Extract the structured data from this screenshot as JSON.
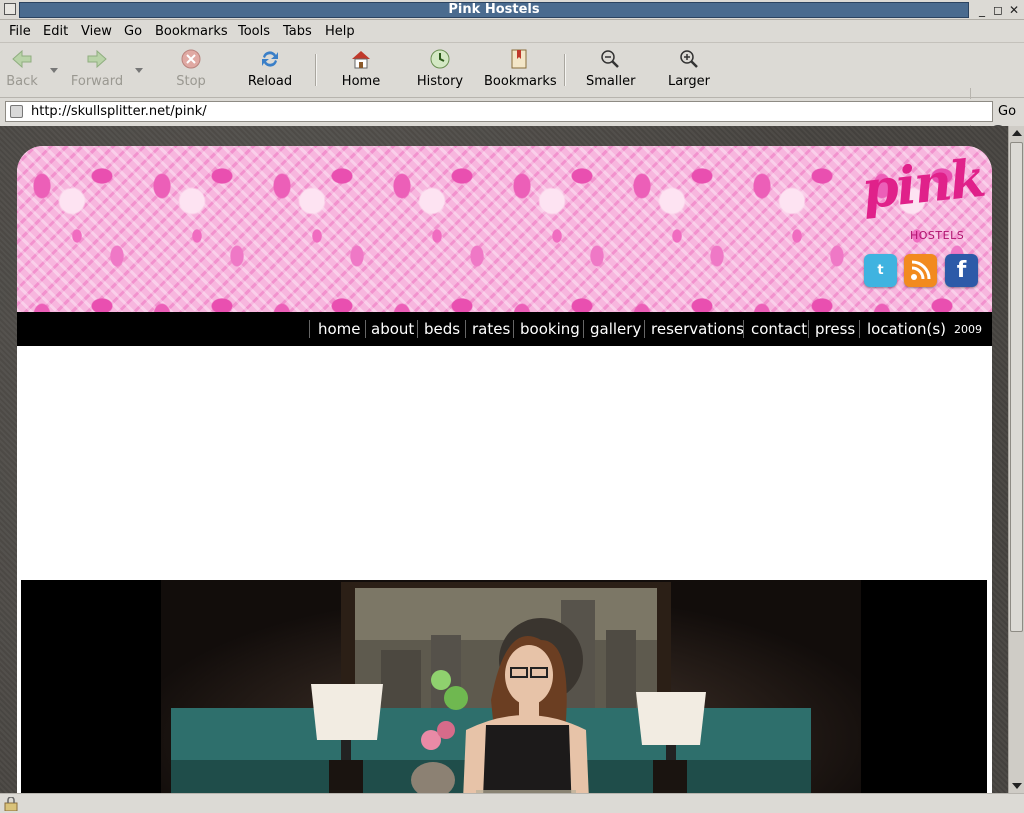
{
  "window": {
    "title": "Pink Hostels",
    "buttons": [
      "minimize-icon",
      "maximize-icon",
      "close-icon"
    ]
  },
  "menu": {
    "items": [
      "File",
      "Edit",
      "View",
      "Go",
      "Bookmarks",
      "Tools",
      "Tabs",
      "Help"
    ]
  },
  "toolbar": {
    "back": "Back",
    "forward": "Forward",
    "stop": "Stop",
    "reload": "Reload",
    "home": "Home",
    "history": "History",
    "bookmarks": "Bookmarks",
    "smaller": "Smaller",
    "larger": "Larger"
  },
  "location": {
    "url": "http://skullsplitter.net/pink/",
    "go": "Go"
  },
  "site": {
    "logo_text": "pink",
    "logo_sub": "HOSTELS",
    "social": [
      "twitter-icon",
      "rss-icon",
      "facebook-icon"
    ],
    "nav": [
      "home",
      "about",
      "beds",
      "rates",
      "booking",
      "gallery",
      "reservations",
      "contact",
      "press",
      "location(s)"
    ],
    "year": "2009"
  },
  "colors": {
    "accent": "#e0218a",
    "nav_bg": "#000000",
    "banner_pink": "#f7b6de"
  }
}
